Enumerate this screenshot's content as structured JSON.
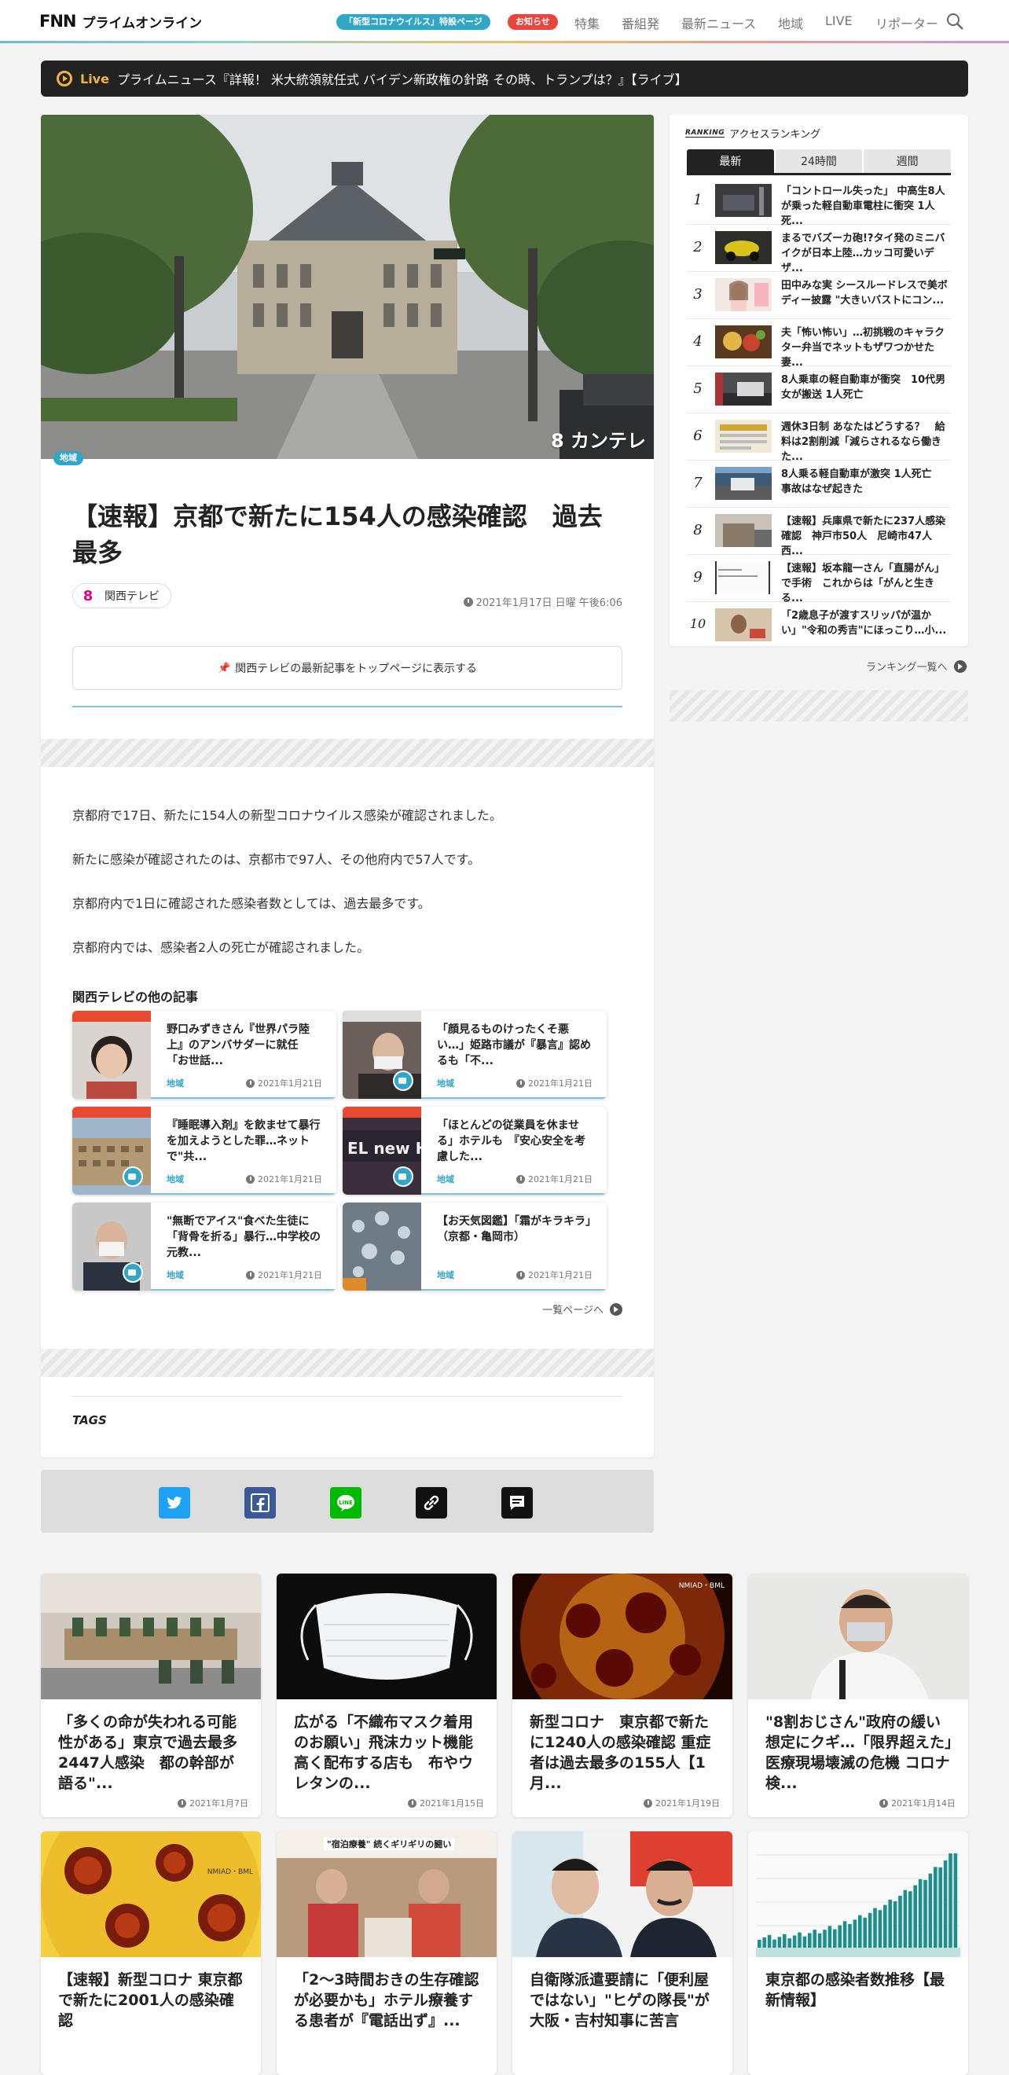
{
  "header": {
    "logo_mark": "FNN",
    "logo_text": "プライムオンライン",
    "pill_corona": "「新型コロナウイルス」特設ページ",
    "pill_notice": "お知らせ",
    "nav": [
      "特集",
      "番組発",
      "最新ニュース",
      "地域",
      "LIVE",
      "リポーター"
    ]
  },
  "live": {
    "label": "Live",
    "text": "プライムニュース『詳報！ 米大統領就任式 バイデン新政権の針路 その時、トランプは？』【ライブ】"
  },
  "article": {
    "hero_watermark": "8 カンテレ",
    "category": "地域",
    "title": "【速報】京都で新たに154人の感染確認　過去最多",
    "source": "関西テレビ",
    "source_mark": "8",
    "date": "2021年1月17日 日曜 午後6:06",
    "pin_button": "関西テレビの最新記事をトップページに表示する",
    "paragraphs": [
      "京都府で17日、新たに154人の新型コロナウイルス感染が確認されました。",
      "新たに感染が確認されたのは、京都市で97人、その他府内で57人です。",
      "京都府内で1日に確認された感染者数としては、過去最多です。",
      "京都府内では、感染者2人の死亡が確認されました。"
    ],
    "related_title": "関西テレビの他の記事",
    "related": [
      {
        "title": "野口みずきさん『世界パラ陸上』のアンバサダーに就任　「お世話...",
        "category": "地域",
        "date": "2021年1月21日"
      },
      {
        "title": "「顔見るものけったくそ悪い…」姫路市議が『暴言』認めるも「不...",
        "category": "地域",
        "date": "2021年1月21日"
      },
      {
        "title": "『睡眠導入剤』を飲ませて暴行を加えようとした罪…ネットで\"共...",
        "category": "地域",
        "date": "2021年1月21日"
      },
      {
        "title": "「ほとんどの従業員を休ませる」ホテルも　『安心安全を考慮した...",
        "category": "地域",
        "date": "2021年1月21日"
      },
      {
        "title": "\"無断でアイス\"食べた生徒に「背骨を折る」暴行…中学校の元教...",
        "category": "地域",
        "date": "2021年1月21日"
      },
      {
        "title": "【お天気図鑑】「霜がキラキラ」（京都・亀岡市）",
        "category": "地域",
        "date": "2021年1月21日"
      }
    ],
    "more_link": "一覧ページへ",
    "tags_label": "TAGS"
  },
  "ranking": {
    "logo": "RANKING",
    "title": "アクセスランキング",
    "tabs": [
      "最新",
      "24時間",
      "週間"
    ],
    "items": [
      {
        "rank": "1",
        "title": "「コントロール失った」 中高生8人が乗った軽自動車電柱に衝突 1人死..."
      },
      {
        "rank": "2",
        "title": "まるでバズーカ砲!?タイ発のミニバイクが日本上陸…カッコ可愛いデザ..."
      },
      {
        "rank": "3",
        "title": "田中みな実 シースルードレスで美ボディー披露 \"大きいバストにコン..."
      },
      {
        "rank": "4",
        "title": "夫「怖い怖い」…初挑戦のキャラクター弁当でネットもザワつかせた妻..."
      },
      {
        "rank": "5",
        "title": "8人乗車の軽自動車が衝突　10代男女が搬送 1人死亡"
      },
      {
        "rank": "6",
        "title": "週休3日制 あなたはどうする？　給料は2割削減「減らされるなら働きた..."
      },
      {
        "rank": "7",
        "title": "8人乗る軽自動車が激突 1人死亡　事故はなぜ起きた"
      },
      {
        "rank": "8",
        "title": "【速報】兵庫県で新たに237人感染確認　神戸市50人　尼崎市47人　西..."
      },
      {
        "rank": "9",
        "title": "【速報】坂本龍一さん「直腸がん」で手術　これからは「がんと生きる..."
      },
      {
        "rank": "10",
        "title": "「2歳息子が渡すスリッパが温かい」\"令和の秀吉\"にほっこり…小..."
      }
    ],
    "more_link": "ランキング一覧へ"
  },
  "grid": [
    {
      "title": "「多くの命が失われる可能性がある」東京で過去最多2447人感染　都の幹部が語る\"...",
      "date": "2021年1月7日"
    },
    {
      "title": "広がる「不織布マスク着用のお願い」飛沫カット機能高く配布する店も　布やウレタンの...",
      "date": "2021年1月15日"
    },
    {
      "title": "新型コロナ　東京都で新たに1240人の感染確認 重症者は過去最多の155人【1月...",
      "date": "2021年1月19日"
    },
    {
      "title": "\"8割おじさん\"政府の緩い想定にクギ…「限界超えた」医療現場壊滅の危機 コロナ検...",
      "date": "2021年1月14日"
    },
    {
      "title": "【速報】新型コロナ 東京都で新たに2001人の感染確認",
      "date": ""
    },
    {
      "title": "「2～3時間おきの生存確認が必要かも」ホテル療養する患者が『電話出ず』...",
      "date": ""
    },
    {
      "title": "自衛隊派遣要請に「便利屋ではない」\"ヒゲの隊長\"が大阪・吉村知事に苦言",
      "date": ""
    },
    {
      "title": "東京都の感染者数推移【最新情報】",
      "date": ""
    }
  ],
  "grid_overlays": {
    "nmiad": "NMIAD・BML",
    "fukugou": "\"宿泊療養\" 続くギリギリの闘い"
  }
}
